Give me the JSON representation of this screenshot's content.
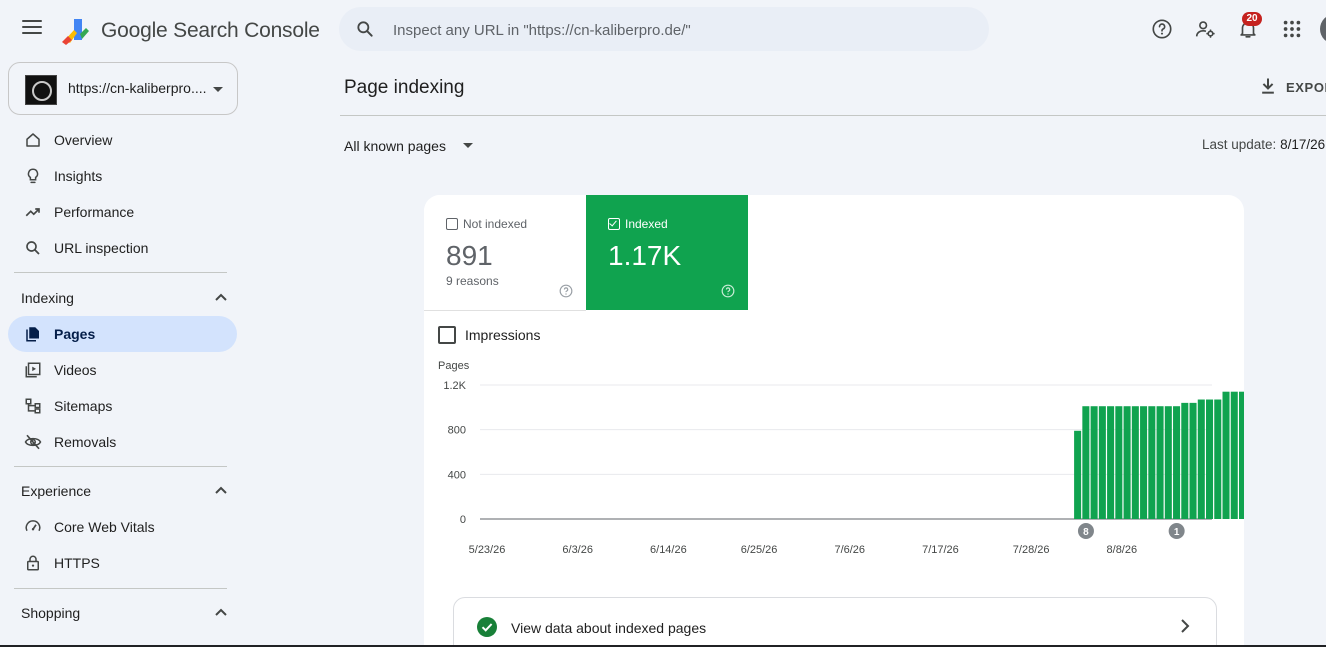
{
  "app": {
    "brand": "Google Search Console",
    "search_placeholder": "Inspect any URL in \"https://cn-kaliberpro.de/\"",
    "notification_count": "20"
  },
  "property": {
    "label": "https://cn-kaliberpro...."
  },
  "sidebar": {
    "top_items": [
      {
        "label": "Overview",
        "icon": "home-icon"
      },
      {
        "label": "Insights",
        "icon": "lightbulb-icon"
      },
      {
        "label": "Performance",
        "icon": "trending-up-icon"
      },
      {
        "label": "URL inspection",
        "icon": "search-icon"
      }
    ],
    "sections": [
      {
        "title": "Indexing",
        "items": [
          {
            "label": "Pages",
            "icon": "pages-icon",
            "active": true
          },
          {
            "label": "Videos",
            "icon": "video-icon"
          },
          {
            "label": "Sitemaps",
            "icon": "sitemap-icon"
          },
          {
            "label": "Removals",
            "icon": "eye-off-icon"
          }
        ]
      },
      {
        "title": "Experience",
        "items": [
          {
            "label": "Core Web Vitals",
            "icon": "gauge-icon"
          },
          {
            "label": "HTTPS",
            "icon": "lock-icon"
          }
        ]
      },
      {
        "title": "Shopping",
        "items": []
      }
    ]
  },
  "main": {
    "title": "Page indexing",
    "export_label": "EXPOR",
    "filter_label": "All known pages",
    "last_update_label": "Last update:",
    "last_update_value": "8/17/26",
    "tiles": {
      "not_indexed": {
        "label": "Not indexed",
        "value": "891",
        "sub": "9 reasons",
        "checked": false
      },
      "indexed": {
        "label": "Indexed",
        "value": "1.17K",
        "checked": true
      }
    },
    "impressions_label": "Impressions",
    "view_data_label": "View data about indexed pages"
  },
  "colors": {
    "accent": "#10a34f",
    "active_nav": "#d3e3fd",
    "background": "#f1f4f9"
  },
  "chart_data": {
    "type": "bar",
    "ylabel": "Pages",
    "ylim": [
      0,
      1200
    ],
    "yticks": [
      0,
      400,
      800,
      1200
    ],
    "ytick_labels": [
      "0",
      "400",
      "800",
      "1.2K"
    ],
    "x_start": "5/23/26",
    "xtick_labels": [
      "5/23/26",
      "6/3/26",
      "6/14/26",
      "6/25/26",
      "7/6/26",
      "7/17/26",
      "7/28/26",
      "8/8/26"
    ],
    "bars_start_day": 72,
    "values": [
      790,
      1010,
      1010,
      1010,
      1010,
      1010,
      1010,
      1010,
      1010,
      1010,
      1010,
      1010,
      1010,
      1040,
      1040,
      1070,
      1070,
      1070,
      1140,
      1140,
      1140,
      1140,
      1170,
      1170,
      1170
    ],
    "annotations": [
      {
        "day": 73,
        "label": "8"
      },
      {
        "day": 84,
        "label": "1"
      }
    ],
    "grid": true
  }
}
